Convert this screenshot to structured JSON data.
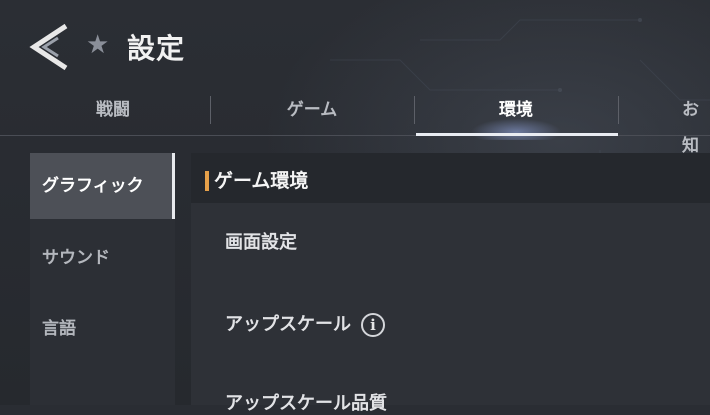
{
  "header": {
    "title": "設定",
    "star_glyph": "★"
  },
  "tabs": [
    {
      "label": "戦闘",
      "active": false
    },
    {
      "label": "ゲーム",
      "active": false
    },
    {
      "label": "環境",
      "active": true
    },
    {
      "label": "お知",
      "active": false
    }
  ],
  "sidebar": {
    "items": [
      {
        "label": "グラフィック",
        "active": true
      },
      {
        "label": "サウンド",
        "active": false
      },
      {
        "label": "言語",
        "active": false
      }
    ]
  },
  "content": {
    "section_title": "ゲーム環境",
    "rows": [
      {
        "label": "画面設定"
      },
      {
        "label": "アップスケール",
        "info_glyph": "i"
      },
      {
        "label": "アップスケール品質"
      }
    ]
  },
  "colors": {
    "accent": "#e7a14a",
    "active_tab_underline": "#e9ecf2",
    "sidebar_active": "#4d5057"
  }
}
